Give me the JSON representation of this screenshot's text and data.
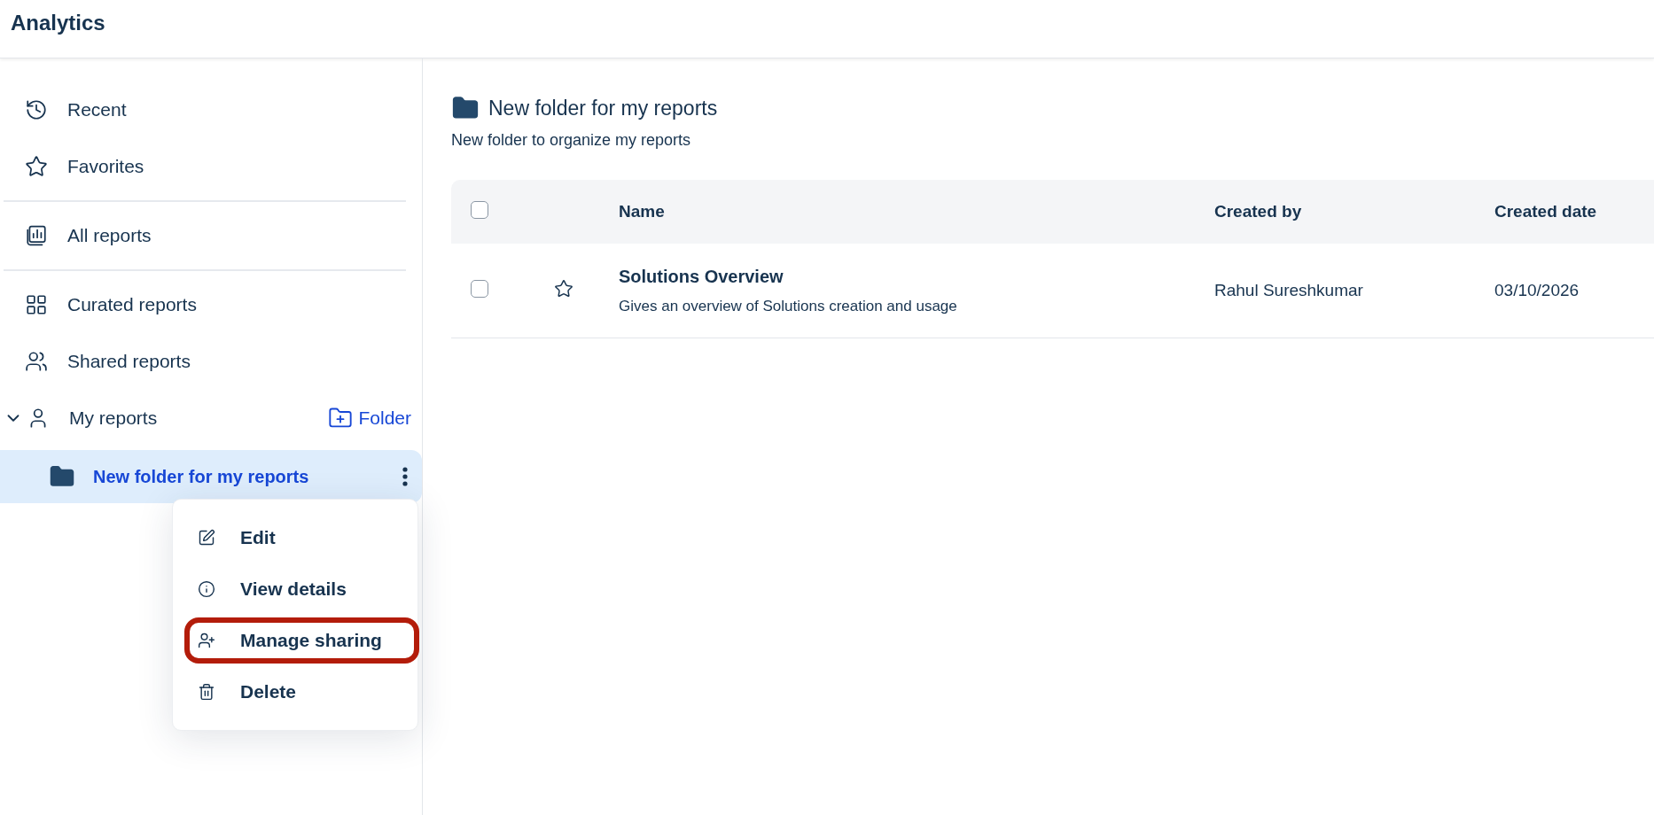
{
  "app_title": "Analytics",
  "sidebar": {
    "groups": [
      {
        "items": [
          {
            "label": "Recent",
            "selected": false
          },
          {
            "label": "Favorites",
            "selected": false
          }
        ]
      },
      {
        "items": [
          {
            "label": "All reports",
            "selected": false
          }
        ]
      },
      {
        "items": [
          {
            "label": "Curated reports",
            "selected": false
          },
          {
            "label": "Shared reports",
            "selected": false
          },
          {
            "label": "My reports",
            "selected": false,
            "expanded": true,
            "action": "Folder",
            "children": [
              {
                "label": "New folder for my reports",
                "selected": true,
                "context_menu": {
                  "items": [
                    {
                      "label": "Edit",
                      "highlighted": false
                    },
                    {
                      "label": "View details",
                      "highlighted": false
                    },
                    {
                      "label": "Manage sharing",
                      "highlighted": true
                    },
                    {
                      "label": "Delete",
                      "highlighted": false
                    }
                  ]
                }
              }
            ]
          }
        ]
      }
    ]
  },
  "folder": {
    "title": "New folder for my reports",
    "description": "New folder to organize my reports"
  },
  "table": {
    "select_all_checked": false,
    "columns": [
      "Name",
      "Created by",
      "Created date"
    ],
    "rows": [
      {
        "checked": false,
        "favorite": false,
        "name": "Solutions Overview",
        "description": "Gives an overview of Solutions creation and usage",
        "created_by": "Rahul Sureshkumar",
        "created_date": "03/10/2026"
      }
    ]
  }
}
